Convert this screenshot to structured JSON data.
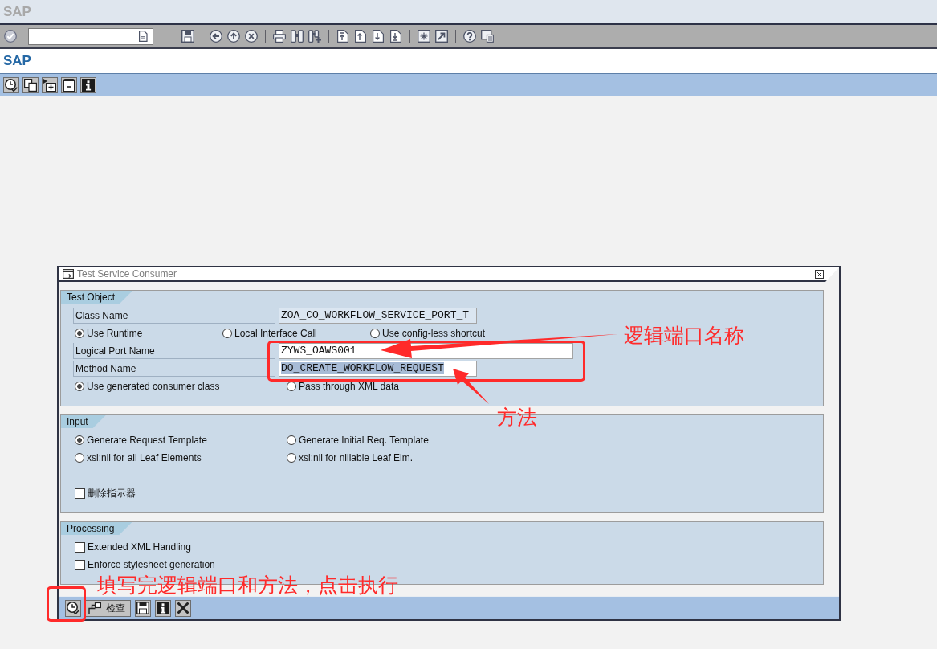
{
  "system_bar": {
    "title": "SAP"
  },
  "screen_title": {
    "title": "SAP"
  },
  "dialog": {
    "title": "Test Service Consumer",
    "groups": [
      {
        "title": "Test Object",
        "rows": [
          {
            "kind": "field",
            "label": "Class Name",
            "value": "ZOA_CO_WORKFLOW_SERVICE_PORT_T",
            "editable": false,
            "highlighted": false
          },
          {
            "kind": "radios",
            "options": [
              {
                "label": "Use Runtime",
                "selected": true
              },
              {
                "label": "Local Interface Call",
                "selected": false
              },
              {
                "label": "Use config-less shortcut",
                "selected": false
              }
            ]
          },
          {
            "kind": "field",
            "label": "Logical Port Name",
            "value": "ZYWS_OAWS001",
            "editable": true,
            "highlighted": false
          },
          {
            "kind": "field",
            "label": "Method Name",
            "value": "DO_CREATE_WORKFLOW_REQUEST",
            "editable": true,
            "highlighted": true
          },
          {
            "kind": "radios",
            "options": [
              {
                "label": "Use generated consumer class",
                "selected": true
              },
              {
                "label": "Pass through XML data",
                "selected": false
              }
            ]
          }
        ]
      },
      {
        "title": "Input",
        "rows": [
          {
            "kind": "radios",
            "options": [
              {
                "label": "Generate Request Template",
                "selected": true
              },
              {
                "label": "Generate Initial Req. Template",
                "selected": false
              }
            ]
          },
          {
            "kind": "radios",
            "options": [
              {
                "label": "xsi:nil for all Leaf Elements",
                "selected": false
              },
              {
                "label": "xsi:nil for nillable Leaf Elm.",
                "selected": false
              }
            ]
          },
          {
            "kind": "checkbox",
            "label": "删除指示器",
            "checked": false
          }
        ]
      },
      {
        "title": "Processing",
        "rows": [
          {
            "kind": "checkbox",
            "label": "Extended XML Handling",
            "checked": false
          },
          {
            "kind": "checkbox",
            "label": "Enforce stylesheet generation",
            "checked": false
          }
        ]
      }
    ],
    "footer": {
      "check_button": {
        "label": "检查"
      }
    }
  },
  "annotations": [
    {
      "text": "逻辑端口名称"
    },
    {
      "text": "方法"
    },
    {
      "text": "填写完逻辑端口和方法，点击执行"
    }
  ]
}
